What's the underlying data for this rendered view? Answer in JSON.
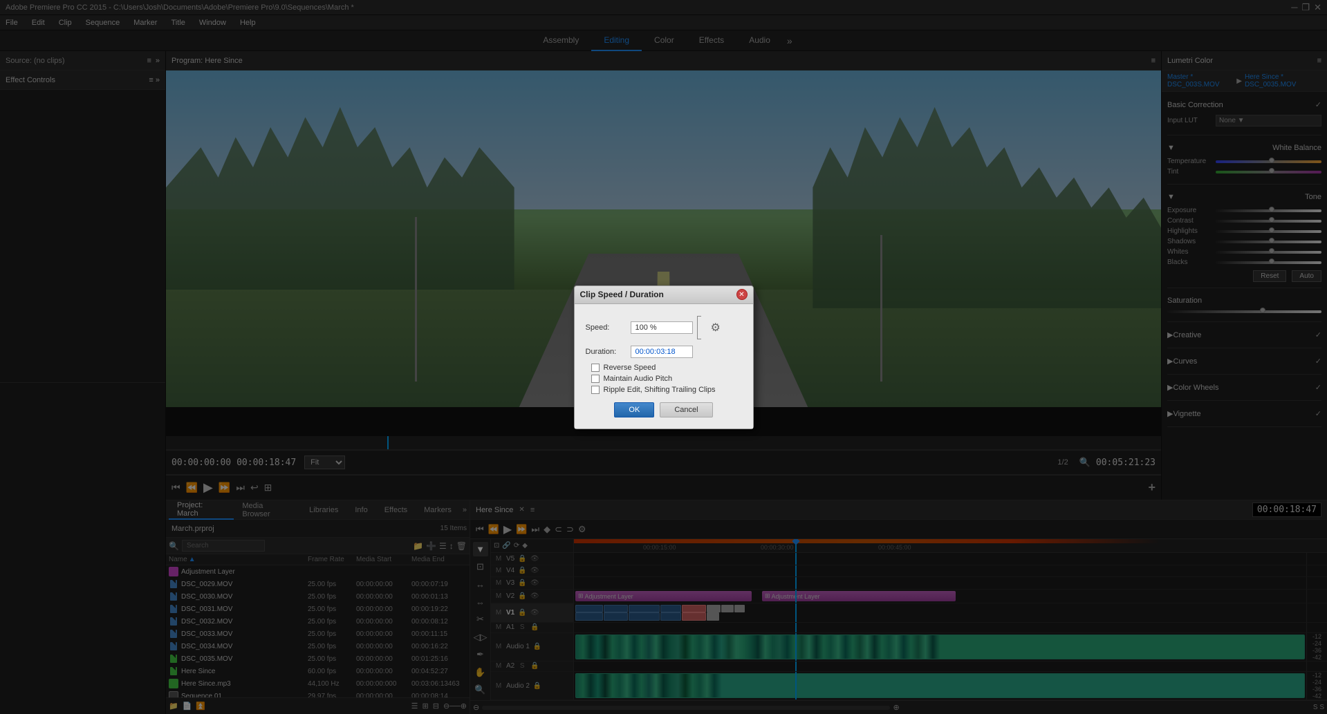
{
  "titlebar": {
    "title": "Adobe Premiere Pro CC 2015 - C:\\Users\\Josh\\Documents\\Adobe\\Premiere Pro\\9.0\\Sequences\\March *",
    "controls": [
      "—",
      "❐",
      "✕"
    ]
  },
  "menubar": {
    "items": [
      "File",
      "Edit",
      "Clip",
      "Sequence",
      "Marker",
      "Title",
      "Window",
      "Help"
    ]
  },
  "workspace_tabs": {
    "tabs": [
      "Assembly",
      "Editing",
      "Color",
      "Effects",
      "Audio"
    ],
    "active": "Editing",
    "more_label": "»"
  },
  "source_panel": {
    "label": "Source: (no clips)",
    "menu_icon": "≡",
    "expand_icon": "»"
  },
  "effect_controls": {
    "label": "Effect Controls",
    "menu_icon": "≡",
    "expand_icon": "»"
  },
  "program_panel": {
    "label": "Program: Here Since",
    "menu_icon": "≡",
    "timecode_left": "00:00:00:00",
    "timecode_right": "00:05:21:23",
    "fit_label": "Fit",
    "page_info": "1/2",
    "timecode_current": "00:00:18:47"
  },
  "lumetri_color": {
    "header_label": "Lumetri Color",
    "menu_icon": "≡",
    "checkmark": "✓",
    "source_label": "Master * DSC_003S.MOV",
    "source2_label": "Here Since * DSC_0035.MOV",
    "sections": [
      {
        "title": "Basic Correction",
        "expanded": true,
        "checkmark": "✓"
      },
      {
        "title": "White Balance",
        "expanded": true,
        "rows": [
          {
            "label": "Temperature",
            "value": "",
            "type": "temp"
          },
          {
            "label": "Tint",
            "value": "",
            "type": "tint"
          }
        ]
      },
      {
        "title": "Tone",
        "expanded": true,
        "rows": [
          {
            "label": "Exposure",
            "value": "",
            "type": "mono"
          },
          {
            "label": "Contrast",
            "value": "",
            "type": "mono"
          },
          {
            "label": "Highlights",
            "value": "",
            "type": "mono"
          },
          {
            "label": "Shadows",
            "value": "",
            "type": "mono"
          },
          {
            "label": "Whites",
            "value": "",
            "type": "mono"
          },
          {
            "label": "Blacks",
            "value": "",
            "type": "mono"
          }
        ]
      },
      {
        "title": "Saturation",
        "type": "mono"
      },
      {
        "title": "Creative",
        "checkmark": "✓"
      },
      {
        "title": "Curves",
        "checkmark": "✓"
      },
      {
        "title": "Color Wheels",
        "checkmark": "✓"
      },
      {
        "title": "Vignette",
        "checkmark": "✓"
      }
    ],
    "reset_label": "Reset",
    "auto_label": "Auto",
    "input_lut_label": "Input LUT",
    "input_lut_value": "None"
  },
  "project": {
    "tabs": [
      "Project: March",
      "Media Browser",
      "Libraries",
      "Info",
      "Effects",
      "Markers"
    ],
    "active_tab": "Project: March",
    "name": "March.prproj",
    "count": "15 Items",
    "col_headers": {
      "name": "Name",
      "frame_rate": "Frame Rate",
      "media_start": "Media Start",
      "media_end": "Media End"
    },
    "files": [
      {
        "icon_color": "#cc44cc",
        "type": "adj",
        "name": "Adjustment Layer",
        "fps": "",
        "start": "",
        "end": ""
      },
      {
        "icon_color": "#4488cc",
        "type": "video",
        "name": "DSC_0029.MOV",
        "fps": "25.00 fps",
        "start": "00:00:00:00",
        "end": "00:00:07:19"
      },
      {
        "icon_color": "#4488cc",
        "type": "video",
        "name": "DSC_0030.MOV",
        "fps": "25.00 fps",
        "start": "00:00:00:00",
        "end": "00:00:01:13"
      },
      {
        "icon_color": "#4488cc",
        "type": "video",
        "name": "DSC_0031.MOV",
        "fps": "25.00 fps",
        "start": "00:00:00:00",
        "end": "00:00:19:22"
      },
      {
        "icon_color": "#4488cc",
        "type": "video",
        "name": "DSC_0032.MOV",
        "fps": "25.00 fps",
        "start": "00:00:00:00",
        "end": "00:00:08:12"
      },
      {
        "icon_color": "#4488cc",
        "type": "video",
        "name": "DSC_0033.MOV",
        "fps": "25.00 fps",
        "start": "00:00:00:00",
        "end": "00:00:11:15"
      },
      {
        "icon_color": "#4488cc",
        "type": "video",
        "name": "DSC_0034.MOV",
        "fps": "25.00 fps",
        "start": "00:00:00:00",
        "end": "00:00:16:22"
      },
      {
        "icon_color": "#44cc44",
        "type": "video",
        "name": "DSC_0035.MOV",
        "fps": "25.00 fps",
        "start": "00:00:00:00",
        "end": "00:01:25:16"
      },
      {
        "icon_color": "#44cc44",
        "type": "video",
        "name": "Here Since",
        "fps": "60.00 fps",
        "start": "00:00:00:00",
        "end": "00:04:52:27"
      },
      {
        "icon_color": "#44cc44",
        "type": "audio",
        "name": "Here Since.mp3",
        "fps": "44,100 Hz",
        "start": "00:00:00:000",
        "end": "00:03:06:13463"
      },
      {
        "icon_color": "#aaaaaa",
        "type": "seq",
        "name": "Sequence 01",
        "fps": "29.97 fps",
        "start": "00:00:00:00",
        "end": "00:00:08:14"
      }
    ]
  },
  "timeline": {
    "tab_name": "Here Since",
    "menu_icon": "≡",
    "timecode": "00:00:18:47",
    "tracks": [
      {
        "label": "V5",
        "type": "video"
      },
      {
        "label": "V4",
        "type": "video"
      },
      {
        "label": "V3",
        "type": "video"
      },
      {
        "label": "V2",
        "type": "video"
      },
      {
        "label": "V1",
        "type": "video",
        "active": true
      },
      {
        "label": "A1",
        "type": "audio"
      },
      {
        "label": "Audio 1",
        "type": "audio",
        "tall": true
      },
      {
        "label": "A2",
        "type": "audio"
      },
      {
        "label": "Audio 2",
        "type": "audio",
        "tall": true
      }
    ],
    "ruler_marks": [
      "00:00:15:00",
      "00:00:30:00",
      "00:00:45:00"
    ]
  },
  "dialog": {
    "title": "Clip Speed / Duration",
    "speed_label": "Speed:",
    "speed_value": "100 %",
    "duration_label": "Duration:",
    "duration_value": "00:00:03:18",
    "reverse_speed_label": "Reverse Speed",
    "maintain_audio_label": "Maintain Audio Pitch",
    "ripple_edit_label": "Ripple Edit, Shifting Trailing Clips",
    "ok_label": "OK",
    "cancel_label": "Cancel"
  },
  "tools": {
    "items": [
      "▼",
      "↔",
      "✂",
      "◇",
      "🖊",
      "⊕",
      "🔍"
    ]
  },
  "timeline_ruler_marks": [
    "00:00:15:00",
    "00:00:30:00",
    "00:00:45:00"
  ]
}
